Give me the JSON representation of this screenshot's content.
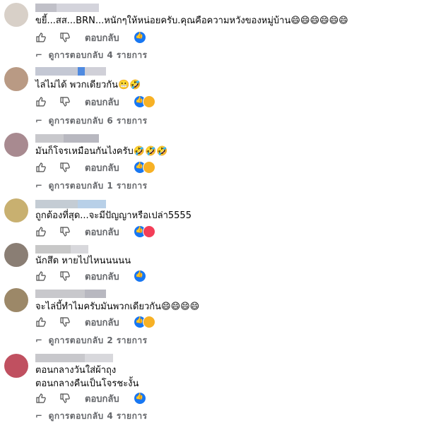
{
  "comments": [
    {
      "text": "ขยี้...สส...BRN...หนักๆให้หน่อยครับ.คุณคือความหวังของหมู่บ้าน😄😄😄😄😄😄",
      "reply_label": "ตอบกลับ",
      "reactions": [
        "like"
      ],
      "view_replies": "ดูการตอบกลับ 4 รายการ",
      "avatar_color": "#d8d0c8",
      "name_color": "#c8c8d0"
    },
    {
      "text": "ไล่ไม่ได้ พวกเดียวกัน😬🤣",
      "reply_label": "ตอบกลับ",
      "reactions": [
        "like",
        "haha"
      ],
      "view_replies": "ดูการตอบกลับ 6 รายการ",
      "avatar_color": "#b99a84",
      "name_color": "#c4c8d4"
    },
    {
      "text": "มันก็โจรเหมือนกันไงครับ🤣🤣🤣",
      "reply_label": "ตอบกลับ",
      "reactions": [
        "like",
        "haha"
      ],
      "view_replies": "ดูการตอบกลับ 1 รายการ",
      "avatar_color": "#a88a90",
      "name_color": "#c8c8cc"
    },
    {
      "text": "ถูกต้องที่สุด...จะมีปัญญาหรือเปล่า5555",
      "reply_label": "ตอบกลับ",
      "reactions": [
        "like",
        "love"
      ],
      "view_replies": "",
      "avatar_color": "#c8b070",
      "name_color": "#c4d0dc"
    },
    {
      "text": "นักสึด หายไปไหนนนนน",
      "reply_label": "ตอบกลับ",
      "reactions": [
        "like"
      ],
      "view_replies": "",
      "avatar_color": "#8a7e74",
      "name_color": "#c8c8c8"
    },
    {
      "text": "จะไล่บี้ทำไมครับมันพวกเดียวกัน😄😄😄😄",
      "reply_label": "ตอบกลับ",
      "reactions": [
        "like",
        "haha"
      ],
      "view_replies": "ดูการตอบกลับ 2 รายการ",
      "avatar_color": "#9c8868",
      "name_color": "#c8c8cc"
    },
    {
      "text": "ตอนกลางวันใส่ผ้าถุง\nตอนกลางคืนเป็นโจรชะงั้น",
      "reply_label": "ตอบกลับ",
      "reactions": [
        "like"
      ],
      "view_replies": "ดูการตอบกลับ 4 รายการ",
      "avatar_color": "#c05060",
      "name_color": "#c8c8cc"
    }
  ]
}
